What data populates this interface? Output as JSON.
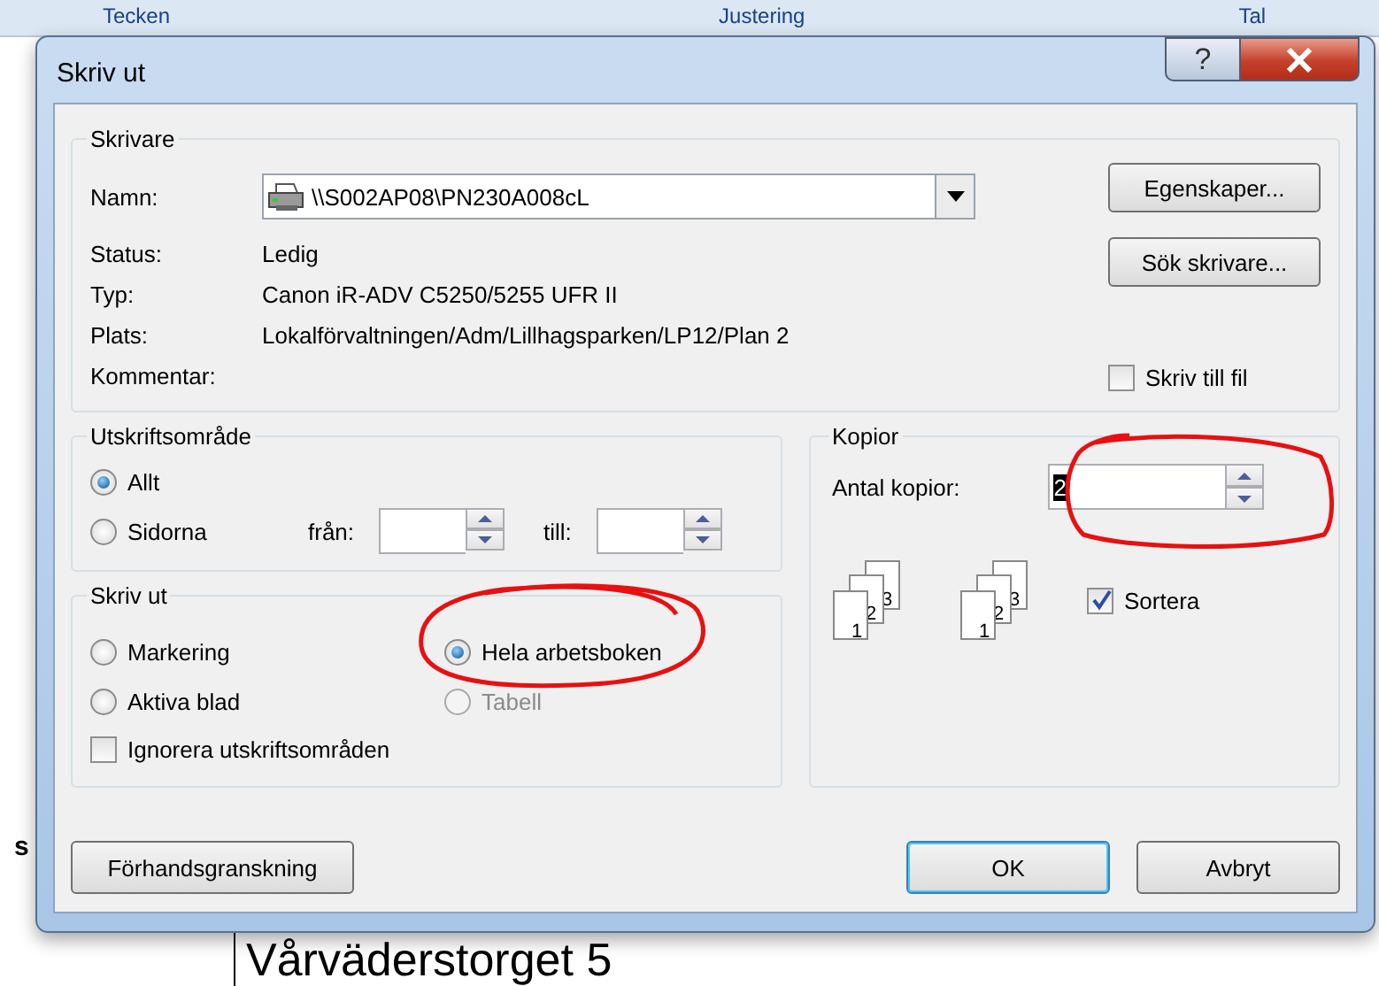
{
  "background": {
    "ribbon_groups": [
      "Tecken",
      "Justering",
      "Tal"
    ],
    "cell_text_left": "s",
    "cell_text": "Vårväderstorget 5"
  },
  "window": {
    "title": "Skriv ut",
    "help": "?"
  },
  "printer": {
    "legend": "Skrivare",
    "name_label": "Namn:",
    "name_value": "\\\\S002AP08\\PN230A008cL",
    "info": [
      {
        "label": "Status:",
        "value": "Ledig"
      },
      {
        "label": "Typ:",
        "value": "Canon iR-ADV C5250/5255 UFR II"
      },
      {
        "label": "Plats:",
        "value": "Lokalförvaltningen/Adm/Lillhagsparken/LP12/Plan 2"
      },
      {
        "label": "Kommentar:"
      }
    ],
    "buttons": [
      "Egenskaper...",
      "Sök skrivare..."
    ],
    "print_to_file": {
      "label": "Skriv till fil",
      "checked": false
    }
  },
  "print_range": {
    "legend": "Utskriftsområde",
    "options": [
      {
        "label": "Allt",
        "selected": true
      },
      {
        "label": "Sidorna",
        "selected": false
      }
    ],
    "from_label": "från:",
    "to_label": "till:"
  },
  "print_what": {
    "legend": "Skriv ut",
    "options": [
      {
        "label": "Markering",
        "selected": false,
        "disabled": false
      },
      {
        "label": "Hela arbetsboken",
        "selected": true,
        "disabled": false
      },
      {
        "label": "Aktiva blad",
        "selected": false,
        "disabled": false
      },
      {
        "label": "Tabell",
        "selected": false,
        "disabled": true
      }
    ],
    "ignore_areas": {
      "label": "Ignorera utskriftsområden",
      "checked": false
    }
  },
  "copies": {
    "legend": "Kopior",
    "count_label": "Antal kopior:",
    "count_value": "2",
    "collate_icons": [
      {
        "pages": [
          "1",
          "2",
          "3"
        ]
      },
      {
        "pages": [
          "1",
          "2",
          "3"
        ]
      }
    ],
    "collate": {
      "label": "Sortera",
      "checked": true
    }
  },
  "buttons": [
    {
      "label": "Förhandsgranskning",
      "default": false
    },
    {
      "label": "OK",
      "default": true
    },
    {
      "label": "Avbryt",
      "default": false
    }
  ]
}
